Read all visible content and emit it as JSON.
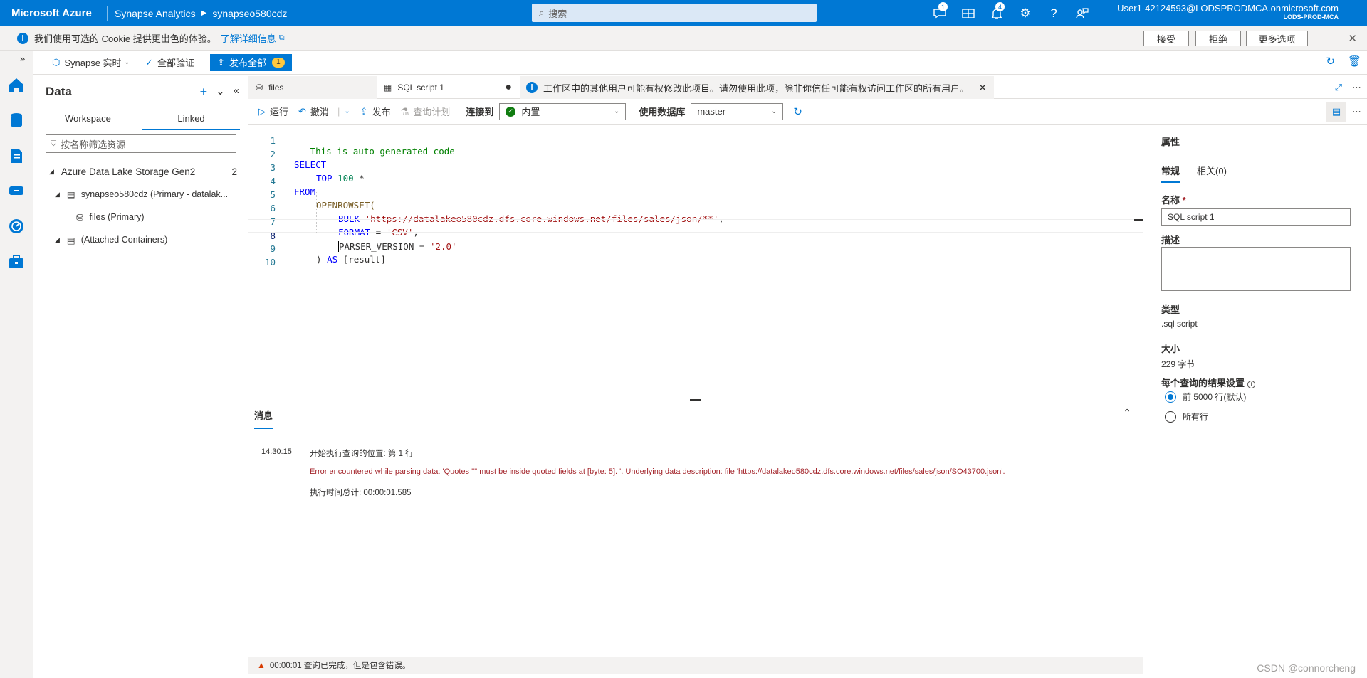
{
  "topbar": {
    "brand": "Microsoft Azure",
    "service": "Synapse Analytics",
    "workspace": "synapseo580cdz",
    "search_placeholder": "搜索",
    "feedback_badge": "1",
    "notifications_badge": "4",
    "user_email": "User1-42124593@LODSPRODMCA.onmicrosoft.com",
    "tenant": "LODS-PROD-MCA"
  },
  "cookie": {
    "text": "我们使用可选的 Cookie 提供更出色的体验。",
    "link": "了解详细信息",
    "accept": "接受",
    "reject": "拒绝",
    "more": "更多选项"
  },
  "global_toolbar": {
    "synapse_live": "Synapse 实时",
    "validate_all": "全部验证",
    "publish_all": "发布全部",
    "publish_count": "1"
  },
  "data_panel": {
    "title": "Data",
    "tabs": [
      "Workspace",
      "Linked"
    ],
    "active_tab": "Linked",
    "filter_placeholder": "按名称筛选资源",
    "tree": {
      "group": "Azure Data Lake Storage Gen2",
      "group_count": "2",
      "account": "synapseo580cdz (Primary - datalak...",
      "container": "files (Primary)",
      "attached": "(Attached Containers)"
    }
  },
  "editor_tabs": {
    "tab1": "files",
    "tab2": "SQL script 1",
    "warning": "工作区中的其他用户可能有权修改此项目。请勿使用此项，除非你信任可能有权访问工作区的所有用户。"
  },
  "script_toolbar": {
    "run": "运行",
    "undo": "撤消",
    "publish": "发布",
    "query_plan": "查询计划",
    "connect_to_label": "连接到",
    "connect_to_value": "内置",
    "use_db_label": "使用数据库",
    "use_db_value": "master"
  },
  "code": {
    "line_numbers": [
      "1",
      "2",
      "3",
      "4",
      "5",
      "6",
      "7",
      "8",
      "9",
      "10"
    ],
    "l1": "-- This is auto-generated code",
    "l2": "SELECT",
    "l3_kw": "TOP",
    "l3_num": "100",
    "l3_rest": "*",
    "l4": "FROM",
    "l5": "OPENROWSET(",
    "l6_kw": "BULK",
    "l6_q1": "'",
    "l6_url": "https://datalakeo580cdz.dfs.core.windows.net/files/sales/json/**",
    "l6_q2": "'",
    "l6_end": ",",
    "l7_kw": "FORMAT",
    "l7_eq": " = ",
    "l7_str": "'CSV'",
    "l7_end": ",",
    "l8_kw": "PARSER_VERSION",
    "l8_eq": " = ",
    "l8_str": "'2.0'",
    "l9_paren": ")",
    "l9_kw": "AS",
    "l9_rest": "[result]"
  },
  "results": {
    "tab": "消息",
    "time": "14:30:15",
    "start": "开始执行查询的位置: 第 1 行",
    "error": "Error encountered while parsing data: 'Quotes '\"' must be inside quoted fields at [byte: 5]. '. Underlying data description: file 'https://datalakeo580cdz.dfs.core.windows.net/files/sales/json/SO43700.json'.",
    "total": "执行时间总计: 00:00:01.585",
    "status": "00:00:01 查询已完成，但是包含错误。"
  },
  "properties": {
    "title": "属性",
    "tab_general": "常规",
    "tab_related": "相关(0)",
    "name_label": "名称",
    "name_required": "*",
    "name_value": "SQL script 1",
    "desc_label": "描述",
    "type_label": "类型",
    "type_value": ".sql script",
    "size_label": "大小",
    "size_value": "229 字节",
    "result_setting_label": "每个查询的结果设置",
    "option1": "前 5000 行(默认)",
    "option2": "所有行"
  },
  "watermark": "CSDN @connorcheng",
  "colors": {
    "azure_blue": "#0078d4",
    "error_red": "#a4262c",
    "success_green": "#107c10"
  }
}
